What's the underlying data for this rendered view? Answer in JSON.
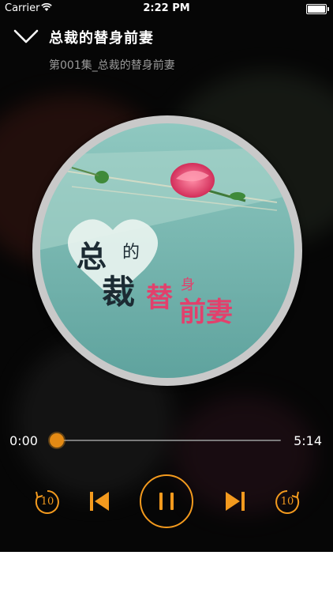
{
  "status_bar": {
    "carrier": "Carrier",
    "time": "2:22 PM"
  },
  "header": {
    "title": "总裁的替身前妻",
    "episode": "第001集_总裁的替身前妻"
  },
  "artwork": {
    "cover_text_line1": "总",
    "cover_text_small": "的",
    "cover_text_line2": "裁",
    "cover_text_red": "替",
    "cover_text_red_small": "身",
    "cover_text_red2": "前妻"
  },
  "player": {
    "current_time": "0:00",
    "total_time": "5:14",
    "progress": 0.0,
    "rewind_seconds": "10",
    "forward_seconds": "10",
    "state": "playing"
  },
  "colors": {
    "accent": "#f39a1e",
    "background": "#0b0b0b",
    "disc_border": "#c9c9c9",
    "teal": "#6fb3ae",
    "rose": "#e2406c"
  },
  "icons": [
    "chevron-down-icon",
    "wifi-icon",
    "battery-icon",
    "replay-10-icon",
    "previous-icon",
    "pause-icon",
    "next-icon",
    "forward-10-icon"
  ]
}
